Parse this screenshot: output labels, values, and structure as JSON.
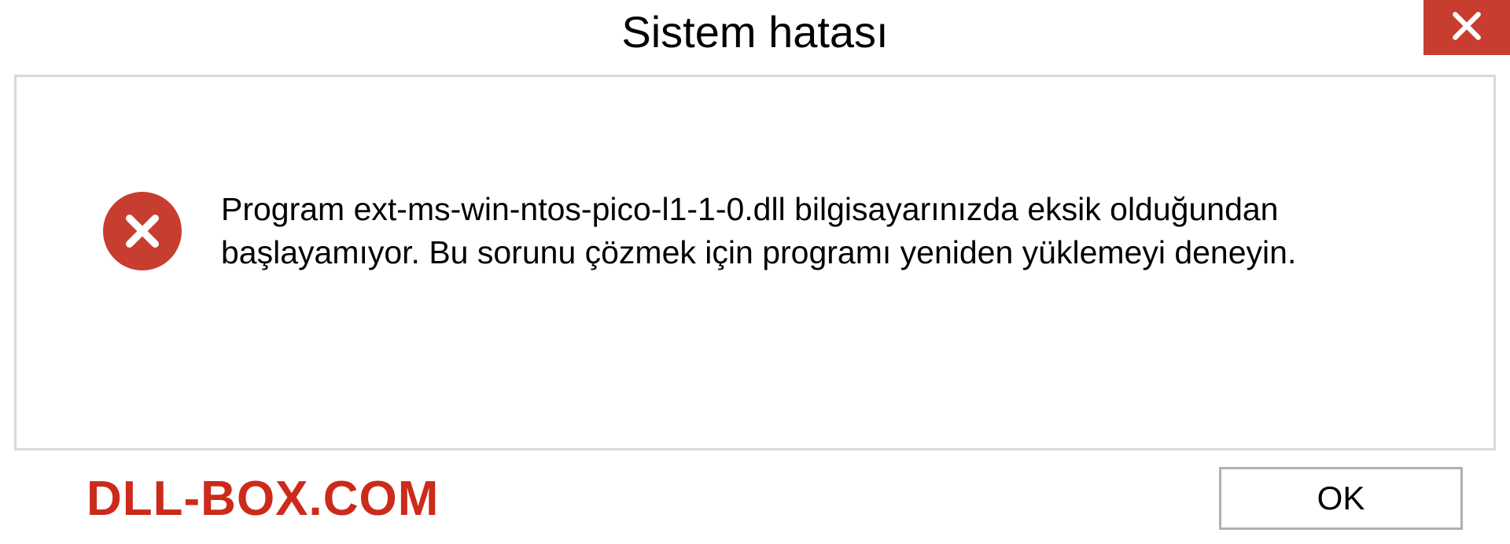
{
  "titlebar": {
    "title": "Sistem hatası"
  },
  "dialog": {
    "message": "Program ext-ms-win-ntos-pico-l1-1-0.dll bilgisayarınızda eksik olduğundan başlayamıyor. Bu sorunu çözmek için programı yeniden yüklemeyi deneyin."
  },
  "footer": {
    "watermark": "DLL-BOX.COM",
    "ok_label": "OK"
  },
  "colors": {
    "error_red": "#c73d2f",
    "watermark_red": "#cc2a1a",
    "border_gray": "#d9d9d9"
  }
}
